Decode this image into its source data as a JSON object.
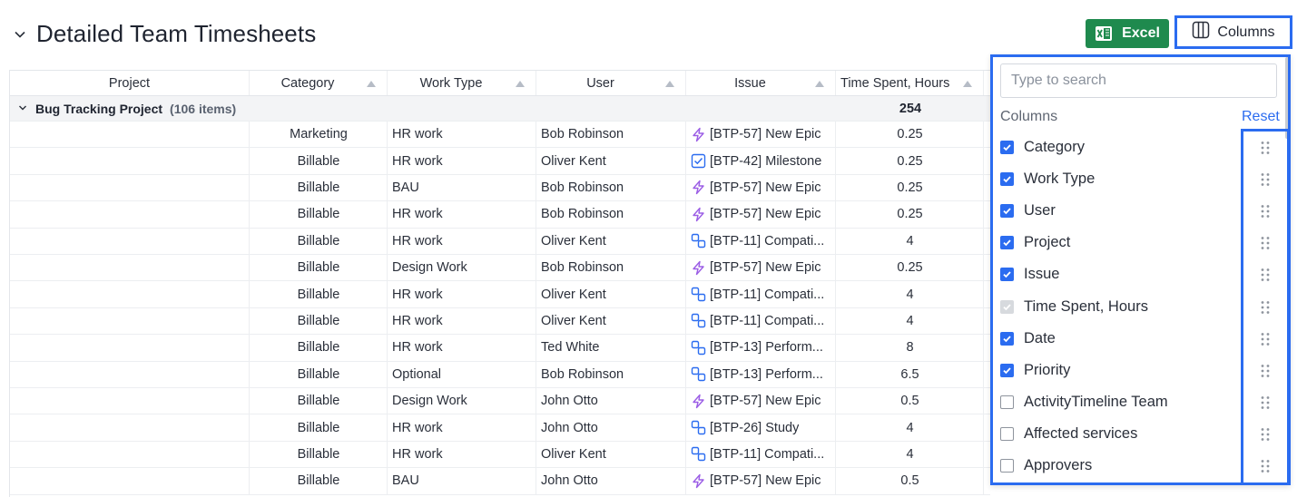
{
  "page": {
    "title": "Detailed Team Timesheets"
  },
  "toolbar": {
    "excel_label": "Excel",
    "columns_label": "Columns"
  },
  "table": {
    "headers": [
      "Project",
      "Category",
      "Work Type",
      "User",
      "Issue",
      "Time Spent, Hours"
    ],
    "group": {
      "name": "Bug Tracking Project",
      "count": "(106 items)",
      "total": "254"
    },
    "rows": [
      {
        "category": "Marketing",
        "work_type": "HR work",
        "user": "Bob Robinson",
        "issue_icon": "epic-icon",
        "issue": "[BTP-57] New Epic",
        "time": "0.25"
      },
      {
        "category": "Billable",
        "work_type": "HR work",
        "user": "Oliver Kent",
        "issue_icon": "milestone-icon",
        "issue": "[BTP-42] Milestone",
        "time": "0.25"
      },
      {
        "category": "Billable",
        "work_type": "BAU",
        "user": "Bob Robinson",
        "issue_icon": "epic-icon",
        "issue": "[BTP-57] New Epic",
        "time": "0.25"
      },
      {
        "category": "Billable",
        "work_type": "HR work",
        "user": "Bob Robinson",
        "issue_icon": "epic-icon",
        "issue": "[BTP-57] New Epic",
        "time": "0.25"
      },
      {
        "category": "Billable",
        "work_type": "HR work",
        "user": "Oliver Kent",
        "issue_icon": "subtask-icon",
        "issue": "[BTP-11] Compati...",
        "time": "4"
      },
      {
        "category": "Billable",
        "work_type": "Design Work",
        "user": "Bob Robinson",
        "issue_icon": "epic-icon",
        "issue": "[BTP-57] New Epic",
        "time": "0.25"
      },
      {
        "category": "Billable",
        "work_type": "HR work",
        "user": "Oliver Kent",
        "issue_icon": "subtask-icon",
        "issue": "[BTP-11] Compati...",
        "time": "4"
      },
      {
        "category": "Billable",
        "work_type": "HR work",
        "user": "Oliver Kent",
        "issue_icon": "subtask-icon",
        "issue": "[BTP-11] Compati...",
        "time": "4"
      },
      {
        "category": "Billable",
        "work_type": "HR work",
        "user": "Ted White",
        "issue_icon": "subtask-icon",
        "issue": "[BTP-13] Perform...",
        "time": "8"
      },
      {
        "category": "Billable",
        "work_type": "Optional",
        "user": "Bob Robinson",
        "issue_icon": "subtask-icon",
        "issue": "[BTP-13] Perform...",
        "time": "6.5"
      },
      {
        "category": "Billable",
        "work_type": "Design Work",
        "user": "John Otto",
        "issue_icon": "epic-icon",
        "issue": "[BTP-57] New Epic",
        "time": "0.5"
      },
      {
        "category": "Billable",
        "work_type": "HR work",
        "user": "John Otto",
        "issue_icon": "subtask-icon",
        "issue": "[BTP-26] Study",
        "time": "4"
      },
      {
        "category": "Billable",
        "work_type": "HR work",
        "user": "Oliver Kent",
        "issue_icon": "subtask-icon",
        "issue": "[BTP-11] Compati...",
        "time": "4"
      },
      {
        "category": "Billable",
        "work_type": "BAU",
        "user": "John Otto",
        "issue_icon": "epic-icon",
        "issue": "[BTP-57] New Epic",
        "time": "0.5"
      }
    ]
  },
  "columns_panel": {
    "search_placeholder": "Type to search",
    "section_label": "Columns",
    "reset_label": "Reset",
    "options": [
      {
        "label": "Category",
        "state": "checked"
      },
      {
        "label": "Work Type",
        "state": "checked"
      },
      {
        "label": "User",
        "state": "checked"
      },
      {
        "label": "Project",
        "state": "checked"
      },
      {
        "label": "Issue",
        "state": "checked"
      },
      {
        "label": "Time Spent, Hours",
        "state": "disabled"
      },
      {
        "label": "Date",
        "state": "checked"
      },
      {
        "label": "Priority",
        "state": "checked"
      },
      {
        "label": "ActivityTimeline Team",
        "state": "unchecked"
      },
      {
        "label": "Affected services",
        "state": "unchecked"
      },
      {
        "label": "Approvers",
        "state": "unchecked"
      }
    ]
  },
  "colors": {
    "accent": "#2b6cf0",
    "excel_green": "#1f8a4e",
    "epic_purple": "#9b5de5",
    "milestone_blue": "#2b6cf0"
  }
}
